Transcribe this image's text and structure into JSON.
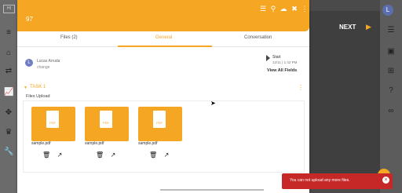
{
  "app": {
    "logo_text": "HI",
    "user_initial": "L"
  },
  "modal": {
    "title": "97",
    "tabs": [
      {
        "label": "Files",
        "count": "(2)"
      },
      {
        "label": "General"
      },
      {
        "label": "Conversation"
      }
    ],
    "user": {
      "name": "Lucas Arruda",
      "action": "change"
    },
    "start": {
      "label": "Start",
      "date": "12/11 | 1:42 PM"
    },
    "view_all": "View All Fields",
    "task": {
      "label": "TASK 1"
    },
    "files_upload_label": "Files Upload",
    "files": [
      {
        "name": "sample.pdf",
        "type": "PDF"
      },
      {
        "name": "sample.pdf",
        "type": "PDF"
      },
      {
        "name": "sample.pdf",
        "type": "PDF"
      }
    ]
  },
  "panel": {
    "next_label": "NEXT"
  },
  "toast": {
    "message": "You can not upload any more files."
  },
  "colors": {
    "accent": "#f5a623",
    "error": "#c62828"
  }
}
